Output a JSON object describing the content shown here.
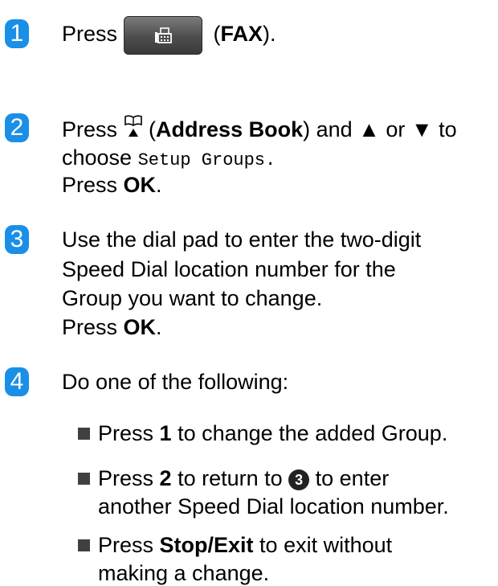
{
  "step1": {
    "number": "1",
    "press": "Press",
    "fax_icon": "fax-icon",
    "open_paren": " (",
    "fax_label": "FAX",
    "close_paren": ")."
  },
  "step2": {
    "number": "2",
    "press": "Press",
    "book_icon": "address-book-icon",
    "open_paren": " (",
    "address_book": "Address Book",
    "and_text": ") and ▲ or ▼ to",
    "choose": "choose ",
    "setup_groups": "Setup Groups",
    "period": ".",
    "press2": "Press ",
    "ok": "OK",
    "ok_period": "."
  },
  "step3": {
    "number": "3",
    "line1": "Use the dial pad to enter the two-digit",
    "line2": "Speed Dial location number for the",
    "line3": "Group you want to change.",
    "press": "Press ",
    "ok": "OK",
    "ok_period": "."
  },
  "step4": {
    "number": "4",
    "intro": "Do one of the following:",
    "options": [
      {
        "press": "Press ",
        "key": "1",
        "rest": " to change the added Group."
      },
      {
        "press": "Press ",
        "key": "2",
        "rest": " to return to ",
        "ref": "3",
        "rest2": " to enter",
        "line2": "another Speed Dial location number."
      },
      {
        "press": "Press ",
        "key": "Stop/Exit",
        "rest": " to exit without",
        "line2": "making a change."
      }
    ]
  },
  "colors": {
    "badge": "#1a8fe8",
    "fax_button": "#4d4d4d",
    "bullet": "#404040"
  }
}
